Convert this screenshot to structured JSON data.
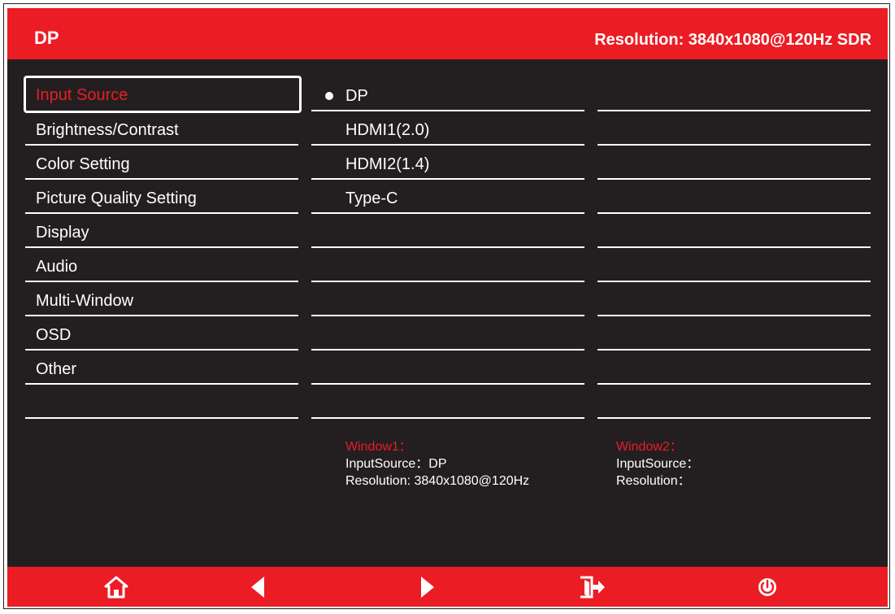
{
  "header": {
    "input_source": "DP",
    "resolution": "Resolution: 3840x1080@120Hz SDR"
  },
  "menu": {
    "items": [
      {
        "label": "Input Source",
        "selected": true
      },
      {
        "label": "Brightness/Contrast"
      },
      {
        "label": "Color Setting"
      },
      {
        "label": "Picture Quality Setting"
      },
      {
        "label": "Display"
      },
      {
        "label": "Audio"
      },
      {
        "label": "Multi-Window"
      },
      {
        "label": "OSD"
      },
      {
        "label": "Other"
      },
      {
        "label": ""
      }
    ]
  },
  "submenu": {
    "items": [
      {
        "label": "DP",
        "active": true
      },
      {
        "label": "HDMI1(2.0)"
      },
      {
        "label": "HDMI2(1.4)"
      },
      {
        "label": "Type-C"
      },
      {
        "label": ""
      },
      {
        "label": ""
      },
      {
        "label": ""
      },
      {
        "label": ""
      },
      {
        "label": ""
      },
      {
        "label": ""
      }
    ]
  },
  "window1": {
    "title": "Window1：",
    "input_source": "InputSource：DP",
    "resolution": "Resolution: 3840x1080@120Hz"
  },
  "window2": {
    "title": "Window2：",
    "input_source": "InputSource：",
    "resolution": "Resolution："
  },
  "footer": {
    "icons": [
      "home-icon",
      "left-arrow-icon",
      "right-arrow-icon",
      "exit-icon",
      "power-icon"
    ]
  },
  "colors": {
    "accent": "#ec1c24",
    "background": "#231f20",
    "text": "#ffffff"
  }
}
